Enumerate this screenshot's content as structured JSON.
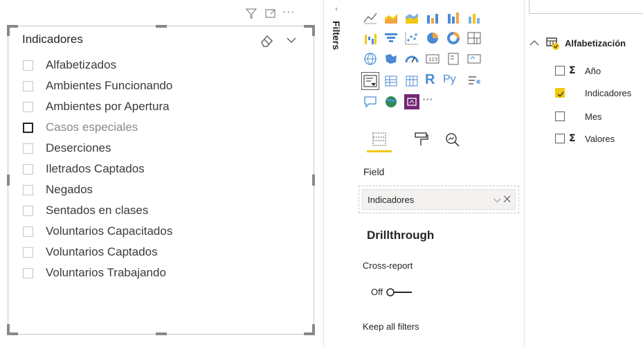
{
  "slicer": {
    "title": "Indicadores",
    "items": [
      {
        "label": "Alfabetizados"
      },
      {
        "label": "Ambientes Funcionando"
      },
      {
        "label": "Ambientes por Apertura"
      },
      {
        "label": "Casos especiales"
      },
      {
        "label": "Deserciones"
      },
      {
        "label": "Iletrados Captados"
      },
      {
        "label": "Negados"
      },
      {
        "label": "Sentados en clases"
      },
      {
        "label": "Voluntarios Capacitados"
      },
      {
        "label": "Voluntarios Captados"
      },
      {
        "label": "Voluntarios Trabajando"
      }
    ],
    "header_icons": [
      "filter-icon",
      "focus-mode-icon",
      "more-options-icon"
    ],
    "more_options_glyph": "···"
  },
  "filters_pane": {
    "label": "Filters"
  },
  "visualizations": {
    "more_visuals_glyph": "···",
    "r_visual_glyph": "R",
    "python_visual_glyph": "Py",
    "field_label": "Field",
    "field_value": "Indicadores",
    "drillthrough_title": "Drillthrough",
    "cross_report_label": "Cross-report",
    "cross_report_value": "Off",
    "keep_all_filters_label": "Keep all filters",
    "accent_color": "#f2c811"
  },
  "fields_pane": {
    "table_name": "Alfabetización",
    "fields": [
      {
        "name": "Año",
        "sigma": "Σ",
        "checked": false
      },
      {
        "name": "Indicadores",
        "sigma": "",
        "checked": true
      },
      {
        "name": "Mes",
        "sigma": "",
        "checked": false
      },
      {
        "name": "Valores",
        "sigma": "Σ",
        "checked": false
      }
    ]
  }
}
